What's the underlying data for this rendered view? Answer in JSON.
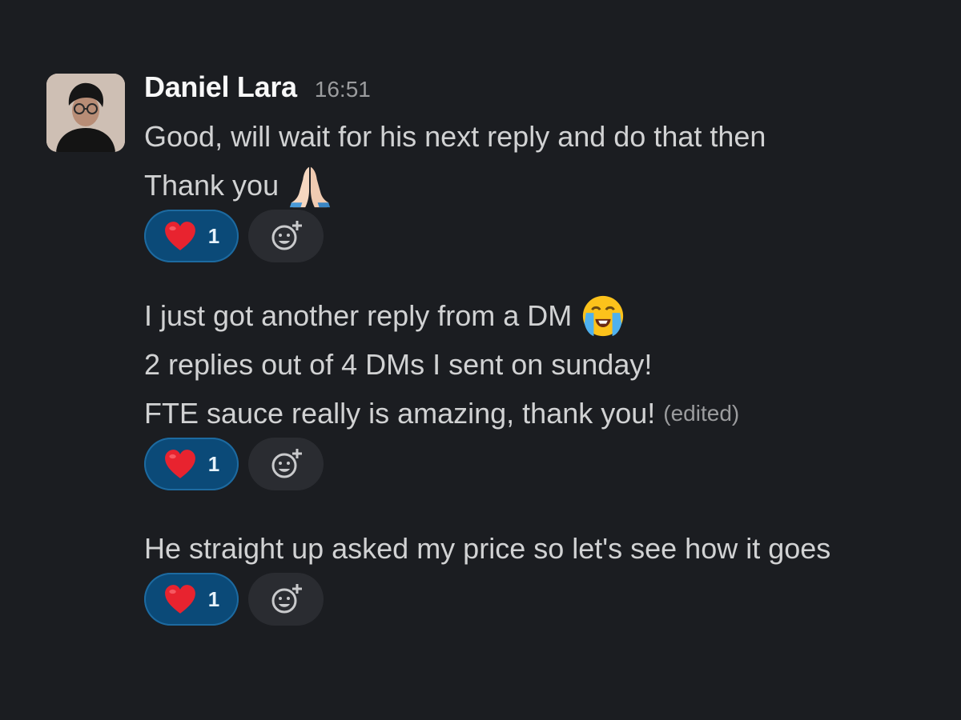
{
  "message": {
    "author": "Daniel Lara",
    "time": "16:51"
  },
  "messages": [
    {
      "lines": [
        "Good, will wait for his next reply and do that then",
        "Thank you"
      ],
      "emoji": "folded-hands",
      "reactions": [
        {
          "emoji": "heart",
          "count": "1"
        }
      ]
    },
    {
      "lines": [
        "I just got another reply from a DM",
        "2 replies out of 4 DMs I sent on sunday!",
        "FTE sauce really is amazing, thank you!"
      ],
      "emoji": "loudly-crying-face",
      "edited": "(edited)",
      "reactions": [
        {
          "emoji": "heart",
          "count": "1"
        }
      ]
    },
    {
      "lines": [
        "He straight up asked my price so let's see how it goes"
      ],
      "reactions": [
        {
          "emoji": "heart",
          "count": "1"
        }
      ]
    }
  ],
  "colors": {
    "background": "#1b1d21",
    "reaction_active": "#0b4a78",
    "text": "#d1d2d3"
  }
}
